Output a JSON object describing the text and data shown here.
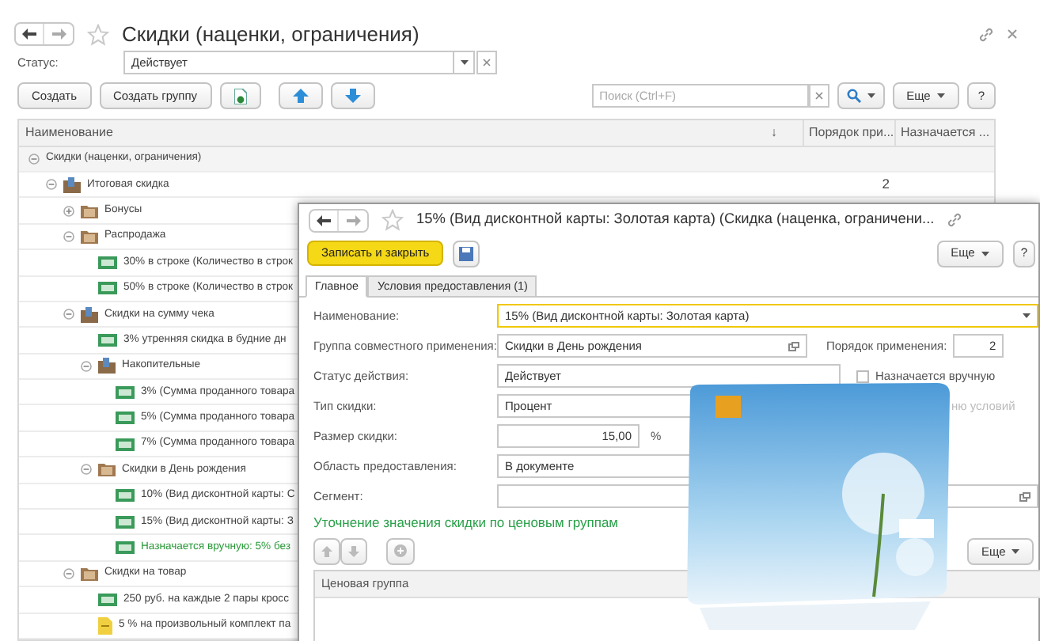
{
  "main_window": {
    "title": "Скидки (наценки, ограничения)",
    "status_filter": {
      "label": "Статус:",
      "value": "Действует"
    },
    "toolbar": {
      "create": "Создать",
      "create_group": "Создать группу",
      "search_placeholder": "Поиск (Ctrl+F)",
      "more": "Еще",
      "help": "?"
    },
    "table": {
      "columns": [
        "Наименование",
        "Порядок при...",
        "Назначается ..."
      ],
      "sort_mark": "↓",
      "rows": [
        {
          "text": "Скидки (наценки, ограничения)",
          "expanded": true,
          "manual": false,
          "children": [
            {
              "text": "Итоговая скидка",
              "kind": "group",
              "expanded": true,
              "manual": false,
              "order": "2",
              "children": [
                {
                  "text": "Бонусы",
                  "kind": "folder",
                  "expanded": false,
                  "manual": false
                },
                {
                  "text": "Распродажа",
                  "kind": "folder",
                  "expanded": true,
                  "manual": false,
                  "children": [
                    {
                      "text": "30% в строке (Количество в строк",
                      "kind": "discount",
                      "manual": false
                    },
                    {
                      "text": "50% в строке (Количество в строк",
                      "kind": "discount",
                      "manual": false
                    }
                  ]
                },
                {
                  "text": "Скидки на сумму чека",
                  "kind": "group",
                  "expanded": true,
                  "manual": false,
                  "children": [
                    {
                      "text": "3% утренняя скидка в будние дн",
                      "kind": "discount",
                      "manual": false
                    },
                    {
                      "text": "Накопительные",
                      "kind": "group",
                      "expanded": true,
                      "manual": false,
                      "children": [
                        {
                          "text": "3% (Сумма проданного товара",
                          "kind": "discount",
                          "manual": false
                        },
                        {
                          "text": "5% (Сумма проданного товара",
                          "kind": "discount",
                          "manual": false
                        },
                        {
                          "text": "7% (Сумма проданного товара",
                          "kind": "discount",
                          "manual": false
                        }
                      ]
                    },
                    {
                      "text": "Скидки в День рождения",
                      "kind": "folder",
                      "expanded": true,
                      "manual": false,
                      "children": [
                        {
                          "text": "10% (Вид дисконтной карты: С",
                          "kind": "discount",
                          "manual": false
                        },
                        {
                          "text": "15% (Вид дисконтной карты: З",
                          "kind": "discount",
                          "manual": false
                        },
                        {
                          "text": "Назначается вручную: 5% без",
                          "kind": "discount",
                          "manual": true
                        }
                      ]
                    }
                  ]
                },
                {
                  "text": "Скидки на товар",
                  "kind": "folder",
                  "expanded": true,
                  "manual": false,
                  "children": [
                    {
                      "text": "250 руб. на каждые 2 пары кросс",
                      "kind": "discount",
                      "manual": false
                    },
                    {
                      "text": "5 % на произвольный комплект па",
                      "kind": "set",
                      "manual": false
                    }
                  ]
                }
              ]
            }
          ]
        }
      ]
    }
  },
  "item_window": {
    "title": "15% (Вид дисконтной карты: Золотая карта) (Скидка (наценка, ограничени...",
    "save_close": "Записать и закрыть",
    "more": "Еще",
    "help": "?",
    "tabs": [
      {
        "label": "Главное",
        "selected": true
      },
      {
        "label": "Условия предоставления (1)",
        "selected": false
      }
    ],
    "name": {
      "label": "Наименование:",
      "value": "15% (Вид дисконтной карты: Золотая карта)"
    },
    "group": {
      "label": "Группа совместного применения:",
      "value": "Скидки в День рождения"
    },
    "order": {
      "label": "Порядок применения:",
      "value": "2"
    },
    "status": {
      "label": "Статус действия:",
      "value": "Действует"
    },
    "manual": {
      "label": "Назначается вручную",
      "checked": false
    },
    "type": {
      "label": "Тип скидки:",
      "value": "Процент"
    },
    "conditions_fragment": "ню условий",
    "size": {
      "label": "Размер скидки:",
      "value": "15,00",
      "unit": "%"
    },
    "area": {
      "label": "Область предоставления:",
      "value": "В документе"
    },
    "segment": {
      "label": "Сегмент:"
    },
    "price_groups": {
      "title": "Уточнение значения скидки по ценовым группам",
      "more": "Еще",
      "column": "Ценовая группа"
    }
  }
}
